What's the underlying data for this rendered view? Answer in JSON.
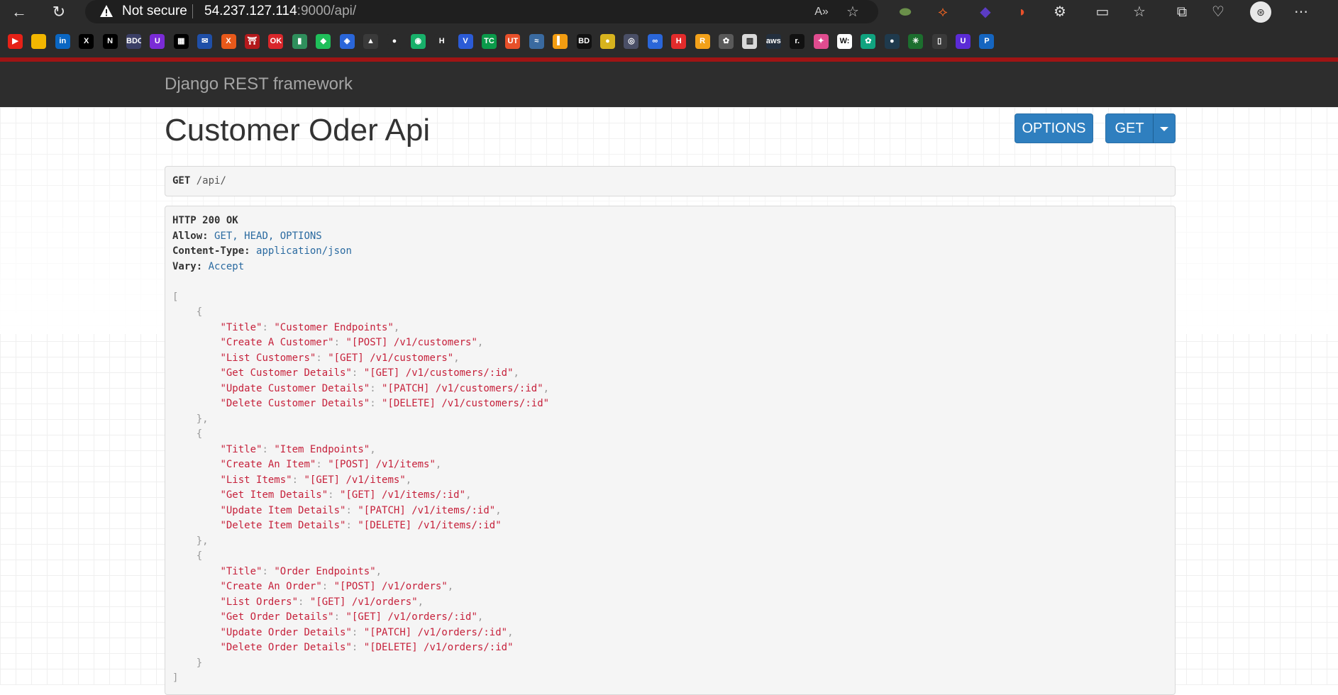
{
  "browser": {
    "security_label": "Not secure",
    "url_host": "54.237.127.114",
    "url_rest": ":9000/api/",
    "icons": [
      "back-icon",
      "reload-icon",
      "warning-icon",
      "read-aloud-icon",
      "favorite-icon",
      "extension-icon",
      "split-screen-icon",
      "favorites-icon",
      "collections-icon",
      "browser-essentials-icon",
      "profile-icon",
      "more-icon"
    ],
    "bookmarks": [
      {
        "icon": "youtube-icon",
        "text": "▶",
        "color": "#e62117"
      },
      {
        "icon": "folder-icon",
        "text": "",
        "color": "#f2b600"
      },
      {
        "icon": "linkedin-icon",
        "text": "in",
        "color": "#0a66c2"
      },
      {
        "icon": "x-icon",
        "text": "X",
        "color": "#000000"
      },
      {
        "icon": "notion-icon",
        "text": "N",
        "color": "#000000"
      },
      {
        "icon": "bdo-icon",
        "text": "BDO",
        "color": "#3b3f66"
      },
      {
        "icon": "ubisoft-icon",
        "text": "U",
        "color": "#7a2bd6"
      },
      {
        "icon": "grid-icon",
        "text": "▦",
        "color": "#000000"
      },
      {
        "icon": "mail-icon",
        "text": "✉",
        "color": "#1f4fa8"
      },
      {
        "icon": "x-orange-icon",
        "text": "X",
        "color": "#e8591a"
      },
      {
        "icon": "gate-icon",
        "text": "⛩",
        "color": "#b3191c"
      },
      {
        "icon": "ok-icon",
        "text": "OK",
        "color": "#d9262a"
      },
      {
        "icon": "chart-icon",
        "text": "▮",
        "color": "#2f8f5c"
      },
      {
        "icon": "gem-icon",
        "text": "◆",
        "color": "#1fbf5a"
      },
      {
        "icon": "jira-icon",
        "text": "◈",
        "color": "#2a66d9"
      },
      {
        "icon": "wolf-icon",
        "text": "▲",
        "color": "#3a3a3a"
      },
      {
        "icon": "github-icon",
        "text": "●",
        "color": "#2b2b2b"
      },
      {
        "icon": "codeium-icon",
        "text": "◉",
        "color": "#18b06a"
      },
      {
        "icon": "jetbrains-icon",
        "text": "H",
        "color": "#2b2b2b"
      },
      {
        "icon": "v-icon",
        "text": "V",
        "color": "#2b5bd6"
      },
      {
        "icon": "techcrunch-icon",
        "text": "TC",
        "color": "#0a9a4a"
      },
      {
        "icon": "ut-icon",
        "text": "UT",
        "color": "#e8502a"
      },
      {
        "icon": "wave-icon",
        "text": "≈",
        "color": "#3a6aa0"
      },
      {
        "icon": "analytics-icon",
        "text": "▍",
        "color": "#f29c11"
      },
      {
        "icon": "bd-icon",
        "text": "BD",
        "color": "#111111"
      },
      {
        "icon": "egg-icon",
        "text": "●",
        "color": "#d7b31e"
      },
      {
        "icon": "globe-icon",
        "text": "◎",
        "color": "#4a4f66"
      },
      {
        "icon": "infinity-icon",
        "text": "∞",
        "color": "#2a66d9"
      },
      {
        "icon": "h-icon",
        "text": "H",
        "color": "#e32b2b"
      },
      {
        "icon": "r-icon",
        "text": "R",
        "color": "#f2a11a"
      },
      {
        "icon": "openai-icon",
        "text": "✿",
        "color": "#5a5a5a"
      },
      {
        "icon": "building-icon",
        "text": "▥",
        "color": "#d9d9d9"
      },
      {
        "icon": "aws-icon",
        "text": "aws",
        "color": "#232f3e"
      },
      {
        "icon": "r-dot-icon",
        "text": "r.",
        "color": "#111111"
      },
      {
        "icon": "sparkle-icon",
        "text": "✦",
        "color": "#e04c8f"
      },
      {
        "icon": "w-icon",
        "text": "W:",
        "color": "#ffffff"
      },
      {
        "icon": "chatgpt-icon",
        "text": "✿",
        "color": "#10a37f"
      },
      {
        "icon": "dark-icon",
        "text": "●",
        "color": "#1f3a4d"
      },
      {
        "icon": "leaf-icon",
        "text": "✳",
        "color": "#1c6e2e"
      },
      {
        "icon": "page-icon",
        "text": "▯",
        "color": "#3a3a3a"
      },
      {
        "icon": "u-icon",
        "text": "U",
        "color": "#5b2bd6"
      },
      {
        "icon": "p-icon",
        "text": "P",
        "color": "#1565c0"
      }
    ]
  },
  "navbar": {
    "brand": "Django REST framework"
  },
  "page": {
    "title": "Customer Oder Api",
    "options_label": "OPTIONS",
    "get_label": "GET"
  },
  "request": {
    "method": "GET",
    "path": "/api/"
  },
  "response": {
    "status": "HTTP 200 OK",
    "headers": [
      {
        "key": "Allow",
        "value": "GET, HEAD, OPTIONS"
      },
      {
        "key": "Content-Type",
        "value": "application/json"
      },
      {
        "key": "Vary",
        "value": "Accept"
      }
    ],
    "body": [
      {
        "entries": [
          {
            "k": "Title",
            "v": "Customer Endpoints"
          },
          {
            "k": "Create A Customer",
            "v": "[POST] /v1/customers"
          },
          {
            "k": "List Customers",
            "v": "[GET] /v1/customers"
          },
          {
            "k": "Get Customer Details",
            "v": "[GET] /v1/customers/:id"
          },
          {
            "k": "Update Customer Details",
            "v": "[PATCH] /v1/customers/:id"
          },
          {
            "k": "Delete Customer Details",
            "v": "[DELETE] /v1/customers/:id"
          }
        ]
      },
      {
        "entries": [
          {
            "k": "Title",
            "v": "Item Endpoints"
          },
          {
            "k": "Create An Item",
            "v": "[POST] /v1/items"
          },
          {
            "k": "List Items",
            "v": "[GET] /v1/items"
          },
          {
            "k": "Get Item Details",
            "v": "[GET] /v1/items/:id"
          },
          {
            "k": "Update Item Details",
            "v": "[PATCH] /v1/items/:id"
          },
          {
            "k": "Delete Item Details",
            "v": "[DELETE] /v1/items/:id"
          }
        ]
      },
      {
        "entries": [
          {
            "k": "Title",
            "v": "Order Endpoints"
          },
          {
            "k": "Create An Order",
            "v": "[POST] /v1/orders"
          },
          {
            "k": "List Orders",
            "v": "[GET] /v1/orders"
          },
          {
            "k": "Get Order Details",
            "v": "[GET] /v1/orders/:id"
          },
          {
            "k": "Update Order Details",
            "v": "[PATCH] /v1/orders/:id"
          },
          {
            "k": "Delete Order Details",
            "v": "[DELETE] /v1/orders/:id"
          }
        ]
      }
    ]
  }
}
